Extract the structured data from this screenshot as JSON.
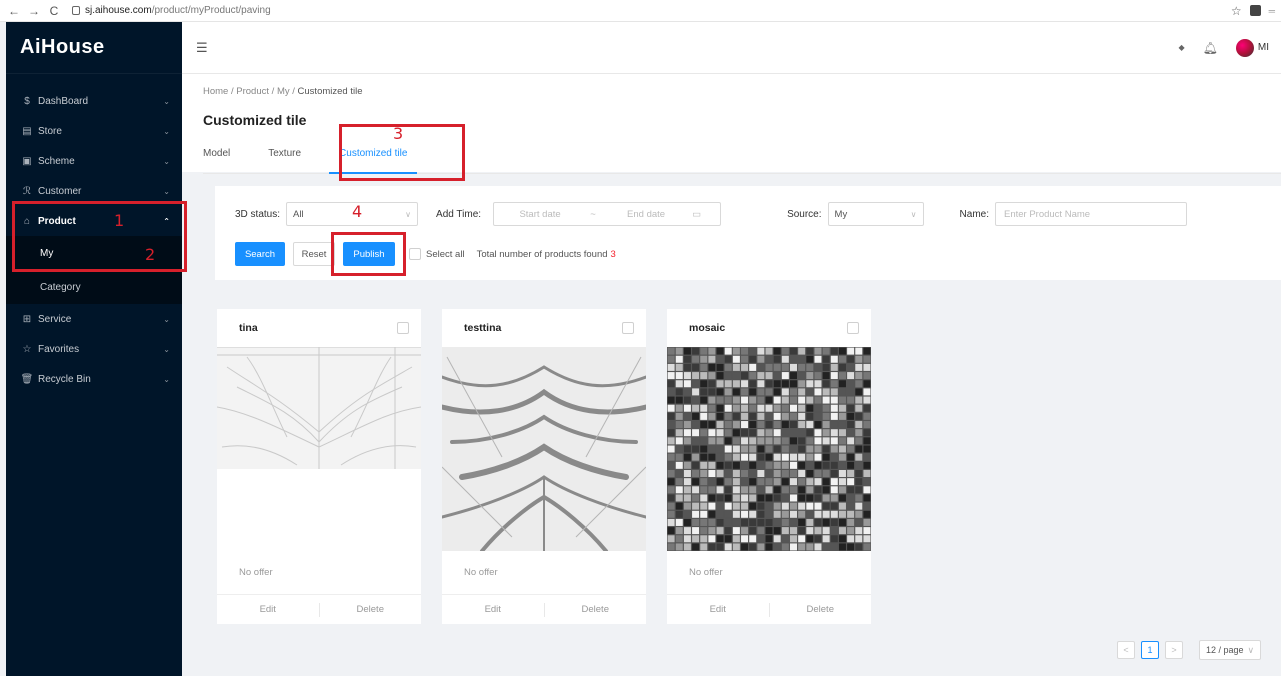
{
  "browser": {
    "url_host": "sj.aihouse.com",
    "url_path": "/product/myProduct/paving",
    "back": "←",
    "forward": "→",
    "reload": "C",
    "star": "☆"
  },
  "app": {
    "logo": "AiHouse",
    "user_abbr": "MI"
  },
  "sidebar": {
    "items": [
      {
        "label": "DashBoard",
        "icon": "$"
      },
      {
        "label": "Store",
        "icon": "▤"
      },
      {
        "label": "Scheme",
        "icon": "▣"
      },
      {
        "label": "Customer",
        "icon": "ℛ"
      },
      {
        "label": "Product",
        "icon": "⌂"
      },
      {
        "label": "Service",
        "icon": "⊞"
      },
      {
        "label": "Favorites",
        "icon": "☆"
      },
      {
        "label": "Recycle Bin",
        "icon": "🗑"
      }
    ],
    "product_sub": [
      {
        "label": "My"
      },
      {
        "label": "Category"
      }
    ]
  },
  "breadcrumb": {
    "home": "Home",
    "sep": "/",
    "product": "Product",
    "my": "My",
    "current": "Customized tile"
  },
  "page_title": "Customized tile",
  "tabs": [
    {
      "label": "Model"
    },
    {
      "label": "Texture"
    },
    {
      "label": "Customized tile"
    }
  ],
  "filters": {
    "status_label": "3D status:",
    "status_value": "All",
    "time_label": "Add Time:",
    "start_placeholder": "Start date",
    "range_sep": "~",
    "end_placeholder": "End date",
    "source_label": "Source:",
    "source_value": "My",
    "name_label": "Name:",
    "name_placeholder": "Enter Product Name",
    "search": "Search",
    "reset": "Reset",
    "publish": "Publish",
    "select_all": "Select all",
    "found_text": "Total number of products found",
    "found_count": "3"
  },
  "cards": [
    {
      "name": "tina",
      "offer": "No offer",
      "edit": "Edit",
      "delete": "Delete"
    },
    {
      "name": "testtina",
      "offer": "No offer",
      "edit": "Edit",
      "delete": "Delete"
    },
    {
      "name": "mosaic",
      "offer": "No offer",
      "edit": "Edit",
      "delete": "Delete"
    }
  ],
  "pagination": {
    "current": "1",
    "prev": "<",
    "next": ">",
    "page_size": "12 / page"
  },
  "annotations": {
    "n1": "1",
    "n2": "2",
    "n3": "3",
    "n4": "4"
  },
  "colors": {
    "accent": "#1890ff",
    "sidebar": "#001529",
    "annotation": "#d6202b",
    "count": "#f5222d"
  }
}
